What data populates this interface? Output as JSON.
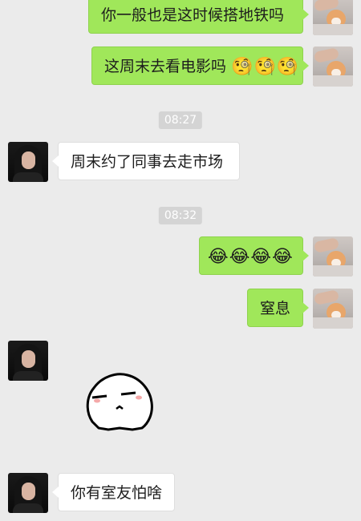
{
  "messages": [
    {
      "side": "right",
      "text": "你一般也是这时候搭地铁吗"
    },
    {
      "side": "right",
      "text": "这周末去看电影吗",
      "emoji": "🧐🧐🧐"
    },
    {
      "type": "time",
      "text": "08:27"
    },
    {
      "side": "left",
      "text": "周末约了同事去走市场"
    },
    {
      "type": "time",
      "text": "08:32"
    },
    {
      "side": "right",
      "emoji": "😂😂😂😂"
    },
    {
      "side": "right",
      "text": "窒息"
    },
    {
      "side": "left",
      "sticker": "smirk-sticker"
    },
    {
      "side": "left",
      "text": "你有室友怕啥"
    }
  ],
  "colors": {
    "background": "#ebebeb",
    "outgoing_bubble": "#a0e75a",
    "incoming_bubble": "#ffffff",
    "timestamp_bg": "#d4d4d4"
  },
  "icons": {
    "contact_avatar": "girl-avatar-icon",
    "self_avatar": "dog-avatar-icon",
    "sticker": "smirk-sticker"
  }
}
